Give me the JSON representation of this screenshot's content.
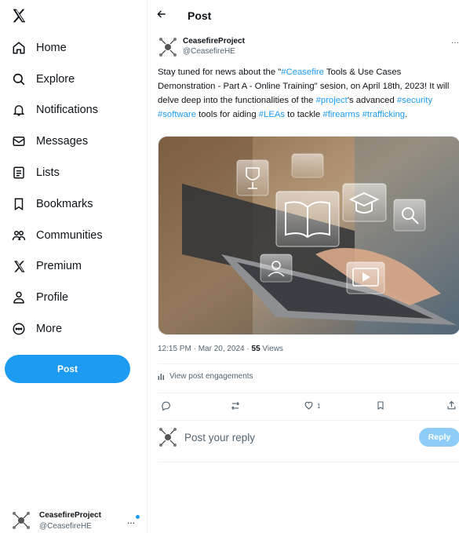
{
  "nav": {
    "items": [
      {
        "label": "Home",
        "icon": "home-icon"
      },
      {
        "label": "Explore",
        "icon": "search-icon"
      },
      {
        "label": "Notifications",
        "icon": "bell-icon"
      },
      {
        "label": "Messages",
        "icon": "envelope-icon"
      },
      {
        "label": "Lists",
        "icon": "list-icon"
      },
      {
        "label": "Bookmarks",
        "icon": "bookmark-icon"
      },
      {
        "label": "Communities",
        "icon": "people-icon"
      },
      {
        "label": "Premium",
        "icon": "x-logo-icon"
      },
      {
        "label": "Profile",
        "icon": "person-icon"
      },
      {
        "label": "More",
        "icon": "more-circle-icon"
      }
    ],
    "post_label": "Post"
  },
  "account": {
    "display_name": "CeasefireProject",
    "handle": "@CeasefireHE",
    "more_label": "..."
  },
  "header": {
    "title": "Post"
  },
  "post": {
    "author": {
      "display_name": "CeasefireProject",
      "handle": "@CeasefireHE"
    },
    "more_label": "...",
    "text": {
      "t1": "Stay tuned for news about the \"",
      "h1": "#Ceasefire",
      "t2": " Tools & Use Cases Demonstration - Part A - Online Training\" sesion, on April 18th, 2023! It will delve deep into the functionalities of the ",
      "h2": "#project",
      "t3": "'s advanced ",
      "h3": "#security",
      "t4": " ",
      "h4": "#software",
      "t5": " tools for aiding ",
      "h5": "#LEAs",
      "t6": " to tackle ",
      "h6": "#firearms",
      "t7": " ",
      "h7": "#trafficking",
      "t8": "."
    },
    "timestamp": "12:15 PM · Mar 20, 2024 · ",
    "views_count": "55",
    "views_label": " Views",
    "engagements_label": "View post engagements",
    "like_count": "1"
  },
  "reply": {
    "placeholder": "Post your reply",
    "button_label": "Reply"
  },
  "colors": {
    "accent": "#1d9bf0",
    "reply_disabled": "#8ecdf7",
    "text_secondary": "#536471"
  }
}
